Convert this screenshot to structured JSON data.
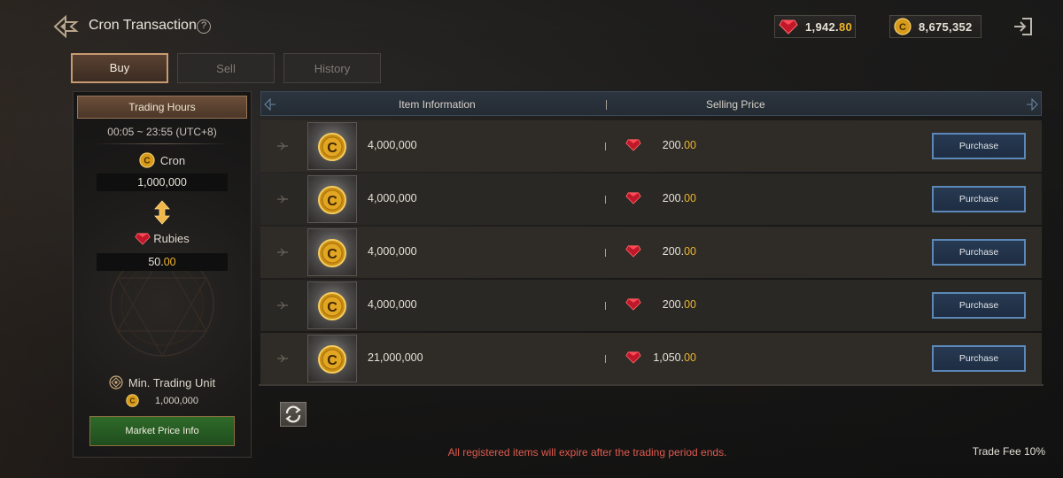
{
  "header": {
    "title": "Cron Transaction",
    "help_icon": "?",
    "rubies": {
      "int": "1,942.",
      "dec": "80"
    },
    "cron": "8,675,352"
  },
  "tabs": [
    {
      "label": "Buy",
      "active": true
    },
    {
      "label": "Sell",
      "active": false
    },
    {
      "label": "History",
      "active": false
    }
  ],
  "left_panel": {
    "trading_hours_label": "Trading Hours",
    "hours": "00:05 ~ 23:55 (UTC+8)",
    "cron_label": "Cron",
    "cron_value": "1,000,000",
    "rubies_label": "Rubies",
    "rubies_value": {
      "int": "50.",
      "dec": "00"
    },
    "min_unit_label": "Min. Trading Unit",
    "min_unit_value": "1,000,000",
    "market_price_button": "Market Price Info"
  },
  "table": {
    "col_item": "Item Information",
    "col_price": "Selling Price",
    "rows": [
      {
        "qty": "4,000,000",
        "price_int": "200.",
        "price_dec": "00",
        "button": "Purchase"
      },
      {
        "qty": "4,000,000",
        "price_int": "200.",
        "price_dec": "00",
        "button": "Purchase"
      },
      {
        "qty": "4,000,000",
        "price_int": "200.",
        "price_dec": "00",
        "button": "Purchase"
      },
      {
        "qty": "4,000,000",
        "price_int": "200.",
        "price_dec": "00",
        "button": "Purchase"
      },
      {
        "qty": "21,000,000",
        "price_int": "1,050.",
        "price_dec": "00",
        "button": "Purchase"
      }
    ]
  },
  "footer": {
    "notice": "All registered items will expire after the trading period ends.",
    "trade_fee": "Trade Fee 10%"
  },
  "colors": {
    "accent_gold": "#f0b429",
    "notice_red": "#e05a4f",
    "purchase_blue": "#5b88b8",
    "market_green": "#2f6a2a"
  },
  "icons": {
    "back": "back-arrow-icon",
    "help": "help-icon",
    "ruby": "ruby-icon",
    "cron": "cron-coin-icon",
    "exit": "exit-icon",
    "swap": "swap-arrows-icon",
    "refresh": "refresh-icon"
  }
}
